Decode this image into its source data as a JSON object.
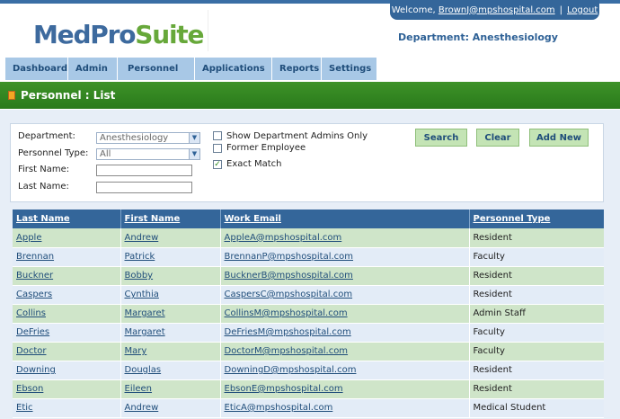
{
  "app": {
    "logo_part1": "MedPro",
    "logo_part2": "Suite"
  },
  "header": {
    "welcome_label": "Welcome,",
    "user_email": "BrownJ@mpshospital.com",
    "separator": "|",
    "logout": "Logout",
    "department_label": "Department: Anesthesiology"
  },
  "nav": {
    "tabs": [
      {
        "label": "Dashboard"
      },
      {
        "label": "Admin"
      },
      {
        "label": "Personnel"
      },
      {
        "label": "Applications"
      },
      {
        "label": "Reports"
      },
      {
        "label": "Settings"
      }
    ]
  },
  "page": {
    "title": "Personnel : List"
  },
  "filter": {
    "department_label": "Department:",
    "department_value": "Anesthesiology",
    "personnel_type_label": "Personnel Type:",
    "personnel_type_value": "All",
    "first_name_label": "First Name:",
    "first_name_value": "",
    "last_name_label": "Last Name:",
    "last_name_value": "",
    "show_admins_label": "Show Department Admins Only",
    "show_admins_checked": false,
    "former_employee_label": "Former Employee",
    "former_employee_checked": false,
    "exact_match_label": "Exact Match",
    "exact_match_checked": true,
    "search_button": "Search",
    "clear_button": "Clear",
    "add_new_button": "Add New"
  },
  "table": {
    "columns": [
      "Last Name",
      "First Name",
      "Work Email",
      "Personnel Type"
    ],
    "rows": [
      [
        "Apple",
        "Andrew",
        "AppleA@mpshospital.com",
        "Resident"
      ],
      [
        "Brennan",
        "Patrick",
        "BrennanP@mpshospital.com",
        "Faculty"
      ],
      [
        "Buckner",
        "Bobby",
        "BucknerB@mpshospital.com",
        "Resident"
      ],
      [
        "Caspers",
        "Cynthia",
        "CaspersC@mpshospital.com",
        "Resident"
      ],
      [
        "Collins",
        "Margaret",
        "CollinsM@mpshospital.com",
        "Admin Staff"
      ],
      [
        "DeFries",
        "Margaret",
        "DeFriesM@mpshospital.com",
        "Faculty"
      ],
      [
        "Doctor",
        "Mary",
        "DoctorM@mpshospital.com",
        "Faculty"
      ],
      [
        "Downing",
        "Douglas",
        "DowningD@mpshospital.com",
        "Resident"
      ],
      [
        "Ebson",
        "Eileen",
        "EbsonE@mpshospital.com",
        "Resident"
      ],
      [
        "Etic",
        "Andrew",
        "EticA@mpshospital.com",
        "Medical Student"
      ]
    ]
  },
  "colors": {
    "header_blue": "#34669a",
    "banner_green": "#2a7a1b",
    "row_green": "#cfe5c9",
    "row_blue": "#e3ecf7",
    "button_green": "#c4e4b5"
  }
}
